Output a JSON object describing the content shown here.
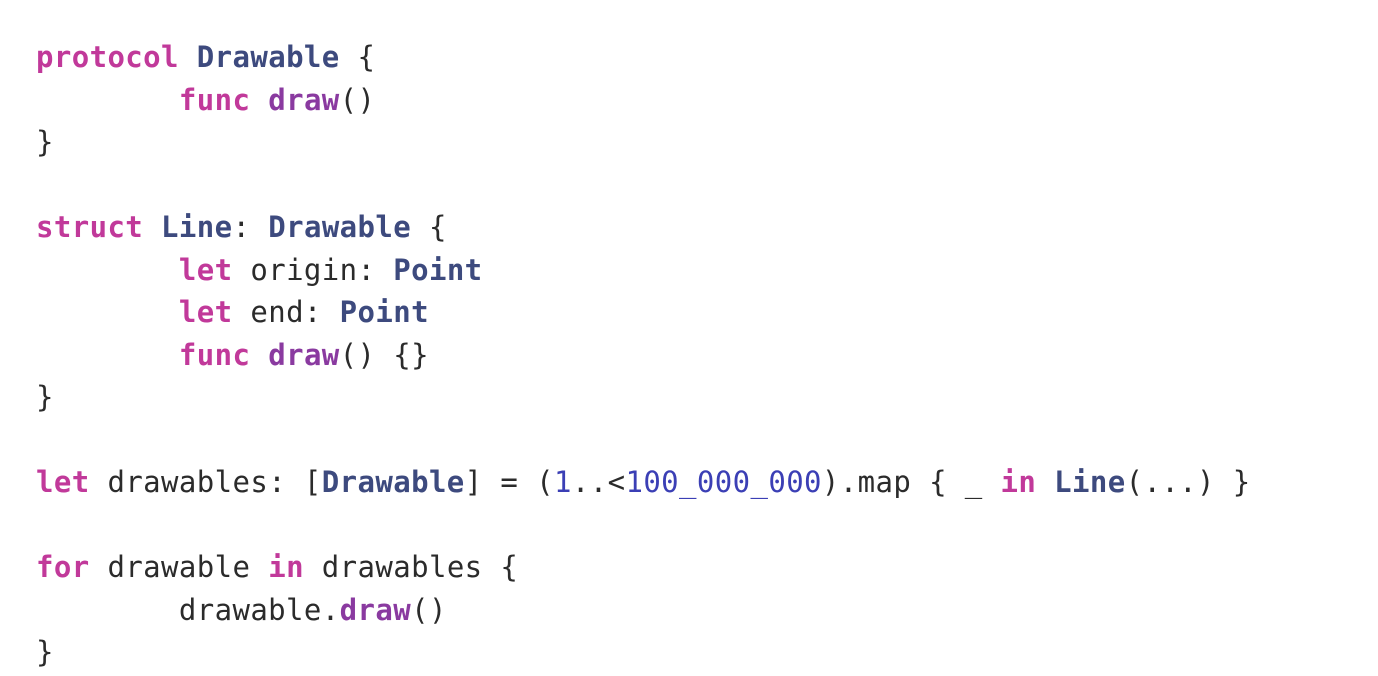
{
  "code_lines": [
    [
      {
        "t": "protocol",
        "c": "kw"
      },
      {
        "t": " ",
        "c": "plain"
      },
      {
        "t": "Drawable",
        "c": "type"
      },
      {
        "t": " {",
        "c": "plain"
      }
    ],
    [
      {
        "t": "        ",
        "c": "plain"
      },
      {
        "t": "func",
        "c": "kw"
      },
      {
        "t": " ",
        "c": "plain"
      },
      {
        "t": "draw",
        "c": "fn"
      },
      {
        "t": "()",
        "c": "plain"
      }
    ],
    [
      {
        "t": "}",
        "c": "plain"
      }
    ],
    [],
    [
      {
        "t": "struct",
        "c": "kw"
      },
      {
        "t": " ",
        "c": "plain"
      },
      {
        "t": "Line",
        "c": "type"
      },
      {
        "t": ": ",
        "c": "plain"
      },
      {
        "t": "Drawable",
        "c": "type"
      },
      {
        "t": " {",
        "c": "plain"
      }
    ],
    [
      {
        "t": "        ",
        "c": "plain"
      },
      {
        "t": "let",
        "c": "kw"
      },
      {
        "t": " origin: ",
        "c": "plain"
      },
      {
        "t": "Point",
        "c": "type"
      }
    ],
    [
      {
        "t": "        ",
        "c": "plain"
      },
      {
        "t": "let",
        "c": "kw"
      },
      {
        "t": " end: ",
        "c": "plain"
      },
      {
        "t": "Point",
        "c": "type"
      }
    ],
    [
      {
        "t": "        ",
        "c": "plain"
      },
      {
        "t": "func",
        "c": "kw"
      },
      {
        "t": " ",
        "c": "plain"
      },
      {
        "t": "draw",
        "c": "fn"
      },
      {
        "t": "() {}",
        "c": "plain"
      }
    ],
    [
      {
        "t": "}",
        "c": "plain"
      }
    ],
    [],
    [
      {
        "t": "let",
        "c": "kw"
      },
      {
        "t": " drawables: [",
        "c": "plain"
      },
      {
        "t": "Drawable",
        "c": "type"
      },
      {
        "t": "] = (",
        "c": "plain"
      },
      {
        "t": "1",
        "c": "num"
      },
      {
        "t": "..<",
        "c": "plain"
      },
      {
        "t": "100_000_000",
        "c": "num"
      },
      {
        "t": ").map { _ ",
        "c": "plain"
      },
      {
        "t": "in",
        "c": "kw"
      },
      {
        "t": " ",
        "c": "plain"
      },
      {
        "t": "Line",
        "c": "type"
      },
      {
        "t": "(...) }",
        "c": "plain"
      }
    ],
    [],
    [
      {
        "t": "for",
        "c": "kw"
      },
      {
        "t": " drawable ",
        "c": "plain"
      },
      {
        "t": "in",
        "c": "kw"
      },
      {
        "t": " drawables {",
        "c": "plain"
      }
    ],
    [
      {
        "t": "        drawable.",
        "c": "plain"
      },
      {
        "t": "draw",
        "c": "fn"
      },
      {
        "t": "()",
        "c": "plain"
      }
    ],
    [
      {
        "t": "}",
        "c": "plain"
      }
    ]
  ],
  "colors": {
    "background": "#ffffff",
    "keyword": "#c1399a",
    "type": "#3d4a7e",
    "function": "#8a3aa0",
    "number": "#3b3fb5",
    "plain": "#2b2b2b"
  }
}
